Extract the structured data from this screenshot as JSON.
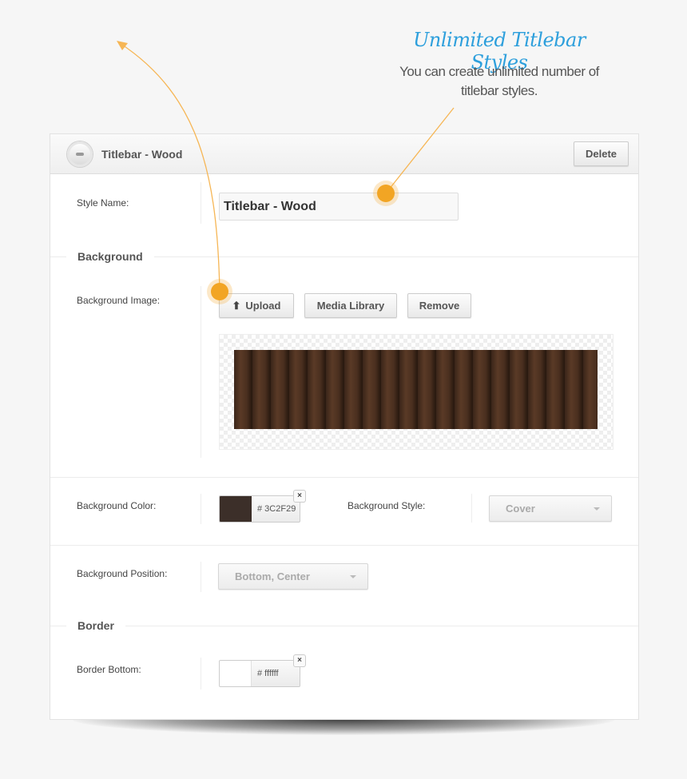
{
  "promo": {
    "title": "Unlimited Titlebar Styles",
    "subtitle_line1": "You can create unlimited number of",
    "subtitle_line2": "titlebar styles."
  },
  "panel": {
    "title": "Titlebar - Wood",
    "delete_label": "Delete",
    "style_name": {
      "label": "Style Name:",
      "value": "Titlebar - Wood"
    },
    "background_section": "Background",
    "background_image": {
      "label": "Background Image:",
      "upload_label": "Upload",
      "media_library_label": "Media Library",
      "remove_label": "Remove"
    },
    "background_color": {
      "label": "Background Color:",
      "hex": "# 3C2F29",
      "color": "#3C2F29",
      "clear": "×"
    },
    "background_style": {
      "label": "Background Style:",
      "value": "Cover"
    },
    "background_position": {
      "label": "Background Position:",
      "value": "Bottom, Center"
    },
    "border_section": "Border",
    "border_bottom": {
      "label": "Border Bottom:",
      "hex": "# ffffff",
      "color": "#ffffff",
      "clear": "×"
    }
  },
  "colors": {
    "accent": "#f2a524",
    "promo_title": "#2d9fdc"
  }
}
